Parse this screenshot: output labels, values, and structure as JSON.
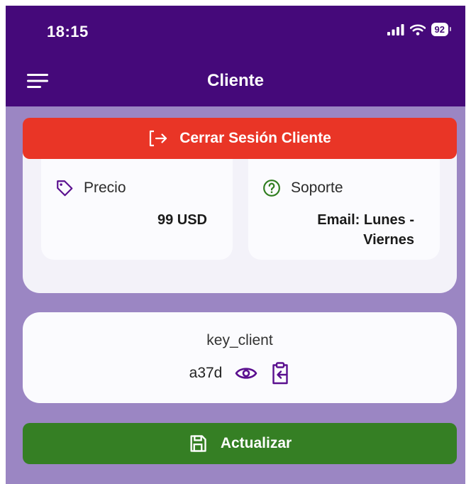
{
  "status_bar": {
    "time": "18:15",
    "battery": "92",
    "icons": [
      "signal-icon",
      "wifi-icon",
      "battery-icon"
    ]
  },
  "header": {
    "title": "Cliente",
    "menu_icon": "hamburger-menu-icon"
  },
  "logout": {
    "label": "Cerrar Sesión Cliente",
    "icon": "logout-icon",
    "color": "#e93526"
  },
  "plan": {
    "price": {
      "label": "Precio",
      "value": "99 USD",
      "icon": "tag-icon"
    },
    "support": {
      "label": "Soporte",
      "value_line1": "Email: Lunes -",
      "value_line2": "Viernes",
      "icon": "help-circle-icon"
    }
  },
  "key": {
    "label": "key_client",
    "value": "a37d",
    "icons": [
      "eye-icon",
      "clipboard-copy-icon"
    ]
  },
  "update": {
    "label": "Actualizar",
    "icon": "save-icon",
    "color": "#357f24"
  },
  "colors": {
    "header": "#45097a",
    "background": "#9b86c3",
    "accent": "#5a0f8f"
  }
}
